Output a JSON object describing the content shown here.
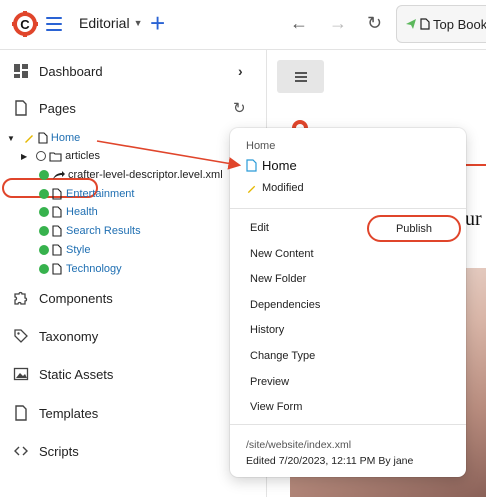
{
  "topbar": {
    "site_label": "Editorial",
    "preview_breadcrumb": "Top Books"
  },
  "sidebar": {
    "items": [
      {
        "label": "Dashboard",
        "icon": "dashboard-icon"
      },
      {
        "label": "Pages",
        "icon": "page-icon"
      },
      {
        "label": "Components",
        "icon": "puzzle-icon"
      },
      {
        "label": "Taxonomy",
        "icon": "tag-icon"
      },
      {
        "label": "Static Assets",
        "icon": "image-icon"
      },
      {
        "label": "Templates",
        "icon": "file-icon"
      },
      {
        "label": "Scripts",
        "icon": "code-icon"
      }
    ],
    "tree": {
      "root": "Home",
      "children": [
        "articles",
        "crafter-level-descriptor.level.xml",
        "Entertainment",
        "Health",
        "Search Results",
        "Style",
        "Technology"
      ]
    }
  },
  "menu": {
    "heading": "Home",
    "item_name": "Home",
    "status": "Modified",
    "actions": [
      "Edit",
      "New Content",
      "New Folder",
      "Dependencies",
      "History",
      "Change Type",
      "Preview",
      "View Form"
    ],
    "publish_label": "Publish",
    "path": "/site/website/index.xml",
    "edited": "Edited 7/20/2023, 12:11 PM By jane"
  },
  "preview": {
    "partial_heading": "ur"
  },
  "colors": {
    "accent_blue": "#2a63d4",
    "link_blue": "#1f6fb2",
    "highlight_red": "#e0452b",
    "status_green": "#37b24d"
  }
}
